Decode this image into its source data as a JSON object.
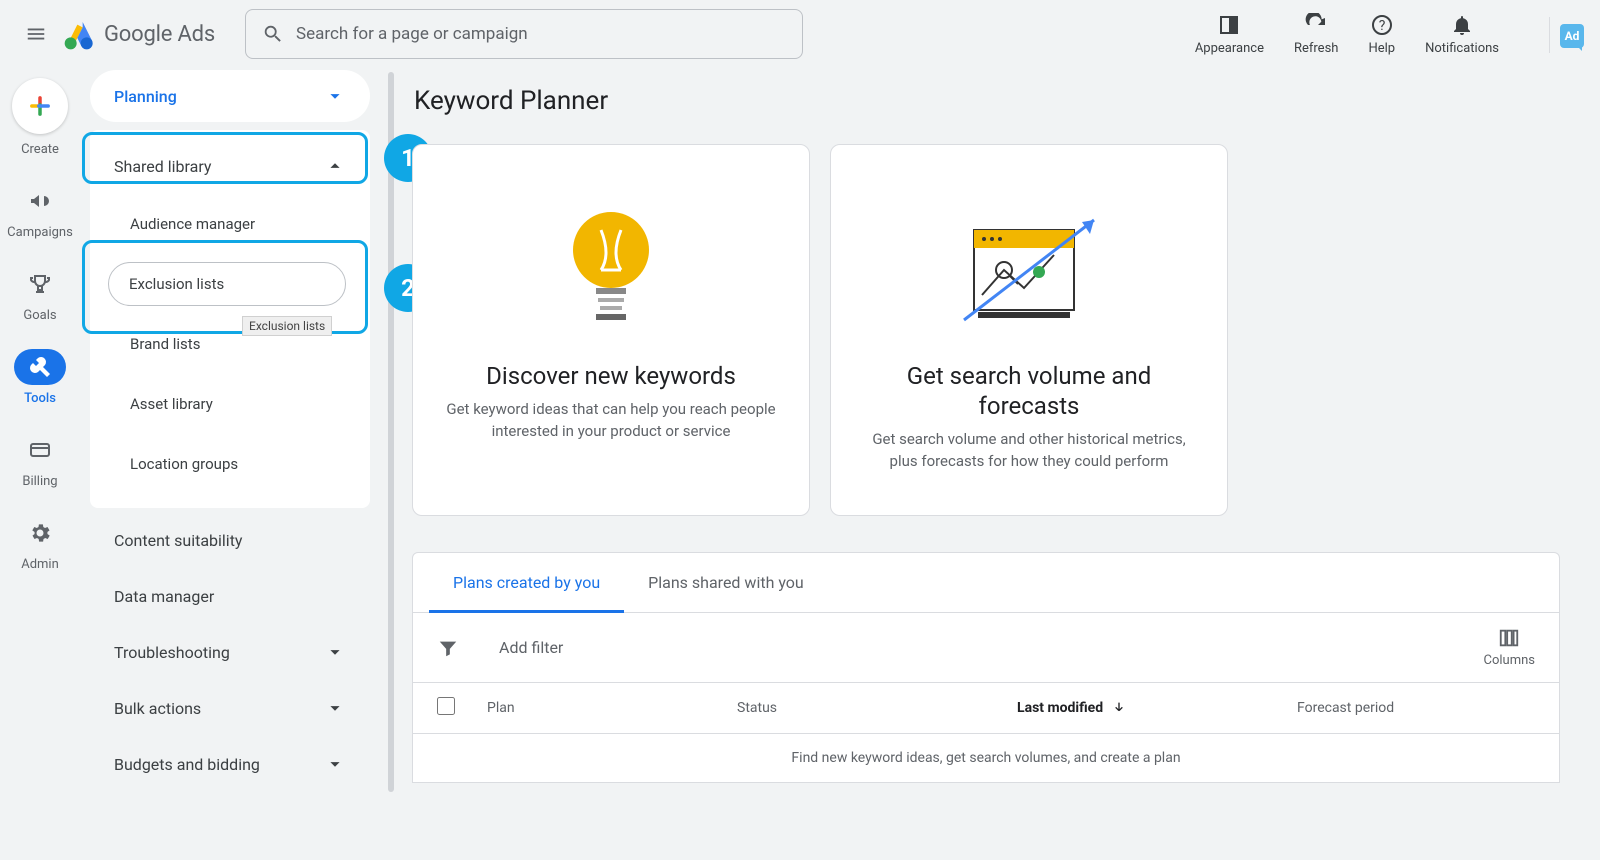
{
  "header": {
    "logo_text": "Google Ads",
    "search_placeholder": "Search for a page or campaign",
    "tools": [
      {
        "id": "appearance",
        "label": "Appearance"
      },
      {
        "id": "refresh",
        "label": "Refresh"
      },
      {
        "id": "help",
        "label": "Help"
      },
      {
        "id": "notifications",
        "label": "Notifications"
      }
    ],
    "ad_badge": "Ad"
  },
  "left_rail": {
    "create": "Create",
    "items": [
      {
        "id": "campaigns",
        "label": "Campaigns",
        "active": false
      },
      {
        "id": "goals",
        "label": "Goals",
        "active": false
      },
      {
        "id": "tools",
        "label": "Tools",
        "active": true
      },
      {
        "id": "billing",
        "label": "Billing",
        "active": false
      },
      {
        "id": "admin",
        "label": "Admin",
        "active": false
      }
    ]
  },
  "subnav": {
    "top_dropdown": "Planning",
    "shared_library": {
      "label": "Shared library",
      "items": [
        "Audience manager",
        "Exclusion lists",
        "Brand lists",
        "Asset library",
        "Location groups"
      ],
      "exclusion_tooltip": "Exclusion lists"
    },
    "other_rows": [
      {
        "label": "Content suitability",
        "chevron": false
      },
      {
        "label": "Data manager",
        "chevron": false
      },
      {
        "label": "Troubleshooting",
        "chevron": true
      },
      {
        "label": "Bulk actions",
        "chevron": true
      },
      {
        "label": "Budgets and bidding",
        "chevron": true
      }
    ]
  },
  "annotations": {
    "step1": "1",
    "step2": "2"
  },
  "main": {
    "title": "Keyword Planner",
    "cards": [
      {
        "title": "Discover new keywords",
        "desc": "Get keyword ideas that can help you reach people interested in your product or service"
      },
      {
        "title": "Get search volume and forecasts",
        "desc": "Get search volume and other historical metrics, plus forecasts for how they could perform"
      }
    ],
    "tabs": [
      {
        "label": "Plans created by you",
        "active": true
      },
      {
        "label": "Plans shared with you",
        "active": false
      }
    ],
    "filter_placeholder": "Add filter",
    "columns_label": "Columns",
    "table": {
      "headers": {
        "plan": "Plan",
        "status": "Status",
        "modified": "Last modified",
        "forecast": "Forecast period"
      },
      "empty": "Find new keyword ideas, get search volumes, and create a plan"
    }
  }
}
